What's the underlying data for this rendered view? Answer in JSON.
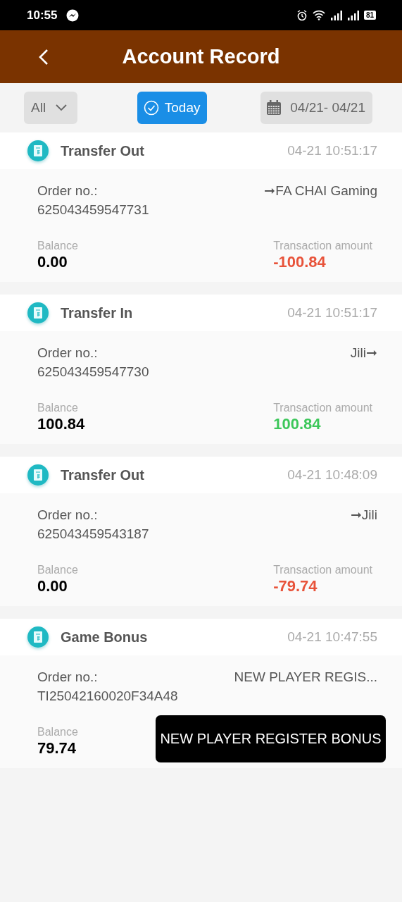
{
  "status_bar": {
    "time": "10:55",
    "battery": "81"
  },
  "header": {
    "title": "Account Record"
  },
  "filters": {
    "type": {
      "value": "All"
    },
    "today": {
      "label": "Today",
      "selected": true
    },
    "date_range": {
      "value": "04/21- 04/21"
    }
  },
  "records": [
    {
      "title": "Transfer Out",
      "time": "04-21 10:51:17",
      "order_label": "Order no.:",
      "order_no": "625043459547731",
      "target": "➞FA CHAI Gaming",
      "balance_label": "Balance",
      "balance": "0.00",
      "amount_label": "Transaction amount",
      "amount": "-100.84",
      "credit": false
    },
    {
      "title": "Transfer In",
      "time": "04-21 10:51:17",
      "order_label": "Order no.:",
      "order_no": "625043459547730",
      "target": "Jili➞",
      "balance_label": "Balance",
      "balance": "100.84",
      "amount_label": "Transaction amount",
      "amount": "100.84",
      "credit": true
    },
    {
      "title": "Transfer Out",
      "time": "04-21 10:48:09",
      "order_label": "Order no.:",
      "order_no": "625043459543187",
      "target": "➞Jili",
      "balance_label": "Balance",
      "balance": "0.00",
      "amount_label": "Transaction amount",
      "amount": "-79.74",
      "credit": false
    },
    {
      "title": "Game Bonus",
      "time": "04-21 10:47:55",
      "order_label": "Order no.:",
      "order_no": "TI25042160020F34A48",
      "target": "NEW PLAYER REGIS...",
      "balance_label": "Balance",
      "balance": "79.74"
    }
  ],
  "toast": {
    "text": "NEW PLAYER REGISTER BONUS"
  }
}
